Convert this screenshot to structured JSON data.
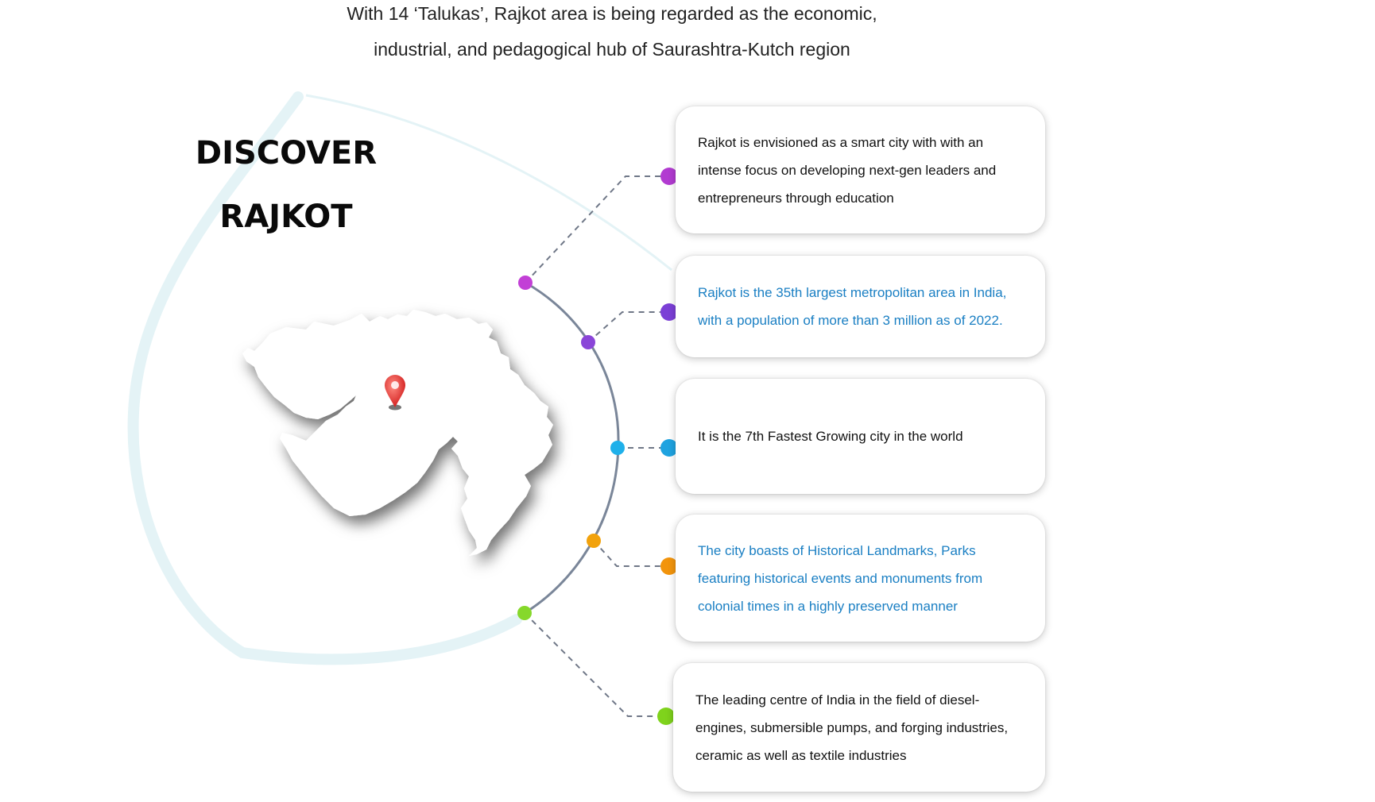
{
  "intro": {
    "line1": "With 14 ‘Talukas’, Rajkot area is being regarded as the economic,",
    "line2": "industrial, and pedagogical hub of Saurashtra-Kutch region"
  },
  "heading": {
    "line1": "DISCOVER",
    "line2": "RAJKOT"
  },
  "map": {
    "label": "Gujarat map",
    "marker_color": "#e23b3b"
  },
  "facts": [
    {
      "text": "Rajkot is envisioned as a smart city with with an intense focus on developing next-gen leaders and entrepreneurs through education",
      "color": "#b23bd1",
      "text_color": "#111111"
    },
    {
      "text": "Rajkot is the 35th largest metropolitan area in India, with a population of more than 3 million as of 2022.",
      "color": "#7b3fd6",
      "text_color": "#1a7fc3"
    },
    {
      "text": "It is the 7th Fastest Growing city in the world",
      "color": "#1fa3e0",
      "text_color": "#111111"
    },
    {
      "text": "The city boasts of Historical Landmarks, Parks featuring historical events and monuments from colonial times in a highly preserved manner",
      "color": "#f2940c",
      "text_color": "#1a7fc3"
    },
    {
      "text": "The leading centre of India in the field of diesel-engines, submersible pumps, and forging industries, ceramic as well as textile industries",
      "color": "#7fd31c",
      "text_color": "#111111"
    }
  ],
  "colors": {
    "arc": "#7a8699",
    "halo": "#e4f3f6",
    "connector": "#6f7787"
  }
}
